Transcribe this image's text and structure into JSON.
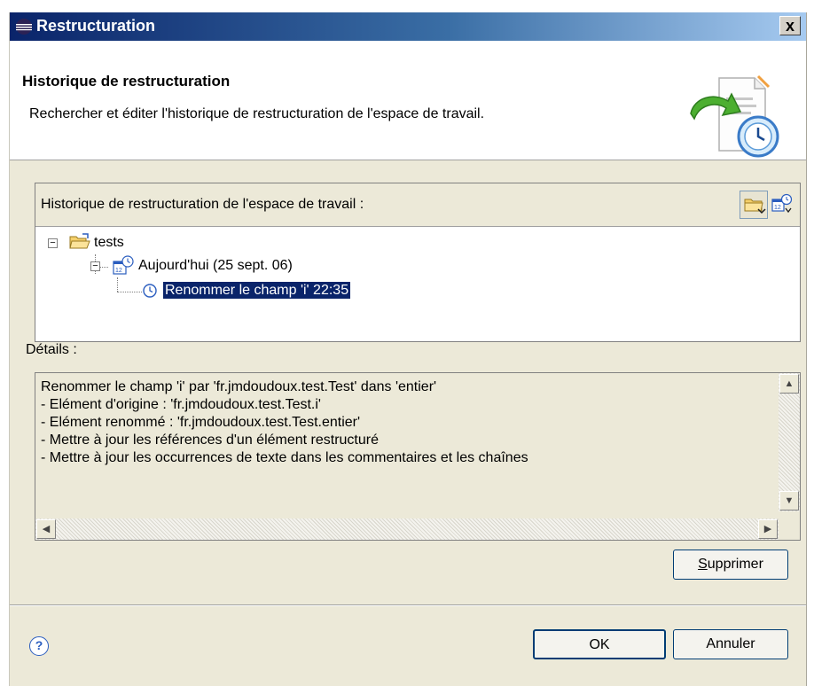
{
  "window": {
    "title": "Restructuration",
    "close_glyph": "x"
  },
  "header": {
    "title": "Historique de restructuration",
    "description": "Rechercher et éditer l'historique de restructuration de l'espace de travail.",
    "image_icon": "refactoring-history-wizard-icon"
  },
  "history": {
    "label": "Historique de restructuration de l'espace de travail :",
    "toolbar": [
      {
        "icon": "group-by-project-icon",
        "pressed": true
      },
      {
        "icon": "sort-by-date-icon",
        "pressed": false
      }
    ],
    "tree": {
      "project": {
        "label": "tests",
        "icon": "folder-open-icon",
        "expanded": true
      },
      "date_group": {
        "label": "Aujourd'hui (25 sept. 06)",
        "icon": "calendar-clock-icon",
        "expanded": true
      },
      "entry": {
        "label": "Renommer le champ 'i' 22:35",
        "icon": "clock-icon",
        "selected": true
      }
    }
  },
  "details": {
    "label": "Détails :",
    "lines": [
      "Renommer le champ 'i' par 'fr.jmdoudoux.test.Test' dans 'entier'",
      "- Elément d'origine : 'fr.jmdoudoux.test.Test.i'",
      "- Elément renommé : 'fr.jmdoudoux.test.Test.entier'",
      "- Mettre à jour les références d'un élément restructuré",
      "- Mettre à jour les occurrences de texte dans les commentaires et les chaînes"
    ]
  },
  "buttons": {
    "delete_first": "S",
    "delete_rest": "upprimer",
    "ok": "OK",
    "cancel": "Annuler"
  },
  "colors": {
    "titlebar_start": "#0a246a",
    "titlebar_end": "#a6caf0",
    "selection": "#0a246a",
    "dialog_bg": "#ece9d8"
  }
}
